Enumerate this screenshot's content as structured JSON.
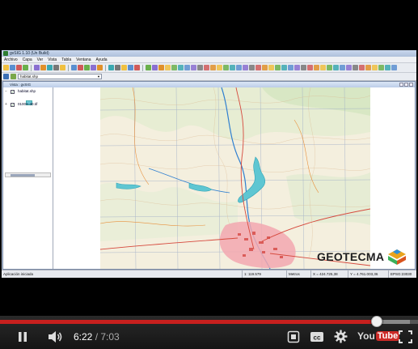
{
  "app": {
    "window_title": "gvSIG 1.10 (Un Build)",
    "menus": [
      "Archivo",
      "Capa",
      "Ver",
      "Vista",
      "Tabla",
      "Ventana",
      "Ayuda"
    ],
    "active_layer": "habitat.shp",
    "view_title": "Vista : gvSIG",
    "layers": [
      {
        "name": "habitat.shp",
        "checked": true,
        "legend_color": "#6ec8d8"
      },
      {
        "name": "0100X-30.tif",
        "checked": true
      }
    ],
    "status": {
      "left": "Aplicación iniciada",
      "scale": "1: 119.579",
      "units": "Metros",
      "x": "X = 424.725,38",
      "y": "Y = 4.761.003,36",
      "crs": "EPSG:23030"
    }
  },
  "watermark": {
    "text": "GEOTECMA",
    "colors": [
      "#3bb05a",
      "#e8a41c",
      "#d9541e",
      "#2d8fd6"
    ]
  },
  "player": {
    "current_time": "6:22",
    "separator": " / ",
    "duration": "7:03",
    "progress_fraction": 0.902,
    "buffered_fraction": 0.98,
    "played_color": "#c8201e",
    "logo_you": "You",
    "logo_tube": "Tube",
    "icons": {
      "play_pause": "pause-icon",
      "volume": "volume-icon",
      "subtitles": "subtitles-icon",
      "settings": "gear-icon",
      "fullscreen": "fullscreen-icon"
    }
  }
}
